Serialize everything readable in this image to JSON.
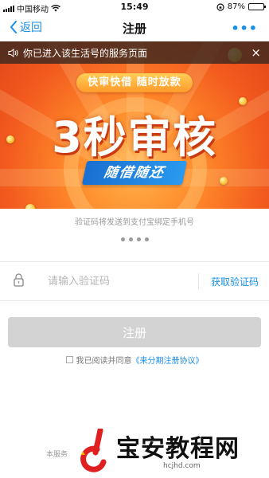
{
  "status_bar": {
    "carrier": "中国移动",
    "time": "15:49",
    "battery": "87%",
    "battery_level": 0.87
  },
  "nav": {
    "back_label": "返回",
    "title": "注册",
    "more": "•••"
  },
  "banner": {
    "notice": "你已进入该生活号的服务页面",
    "close": "×",
    "tagline": "快审快借  随时放款",
    "headline": "3秒审核",
    "subline": "随借随还"
  },
  "form": {
    "sms_hint": "验证码将发送到支付宝绑定手机号",
    "code_placeholder": "请输入验证码",
    "get_code_label": "获取验证码",
    "register_label": "注册",
    "agreement_prefix": "我已阅读并同意",
    "agreement_link": "《来分期注册协议》"
  },
  "footer": {
    "service_note": "本服务",
    "watermark_text": "宝安教程网",
    "watermark_url": "hcjhd.com"
  },
  "colors": {
    "accent": "#1a8fe6",
    "banner_orange": "#f25a1e",
    "button_disabled": "#d3d3d3"
  }
}
